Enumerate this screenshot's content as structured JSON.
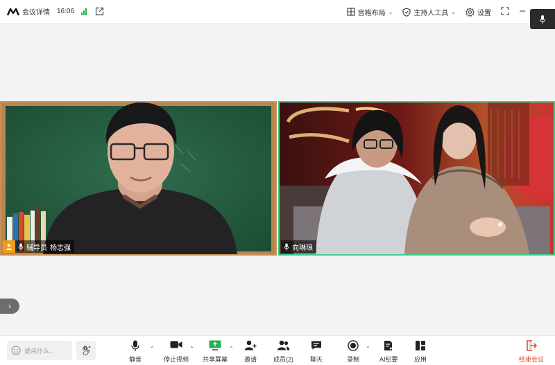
{
  "topbar": {
    "title": "会议详情",
    "time": "16:06",
    "layout_label": "宫格布局",
    "host_tools_label": "主持人工具",
    "settings_label": "设置"
  },
  "participants": [
    {
      "role": "辅导员",
      "name": "杨志强"
    },
    {
      "name": "向琳琅"
    }
  ],
  "chat": {
    "placeholder": "说点什么..."
  },
  "toolbar": {
    "mute": "静音",
    "stop_video": "停止视频",
    "share_screen": "共享屏幕",
    "invite": "邀请",
    "members": "成员(2)",
    "chat": "聊天",
    "record": "录制",
    "ai_minutes": "AI纪要",
    "apps": "应用",
    "end_meeting": "结束会议"
  },
  "colors": {
    "accent_green": "#3ccf8e",
    "signal_green": "#22b14c",
    "end_red": "#e0492f",
    "host_orange": "#f39c12"
  }
}
